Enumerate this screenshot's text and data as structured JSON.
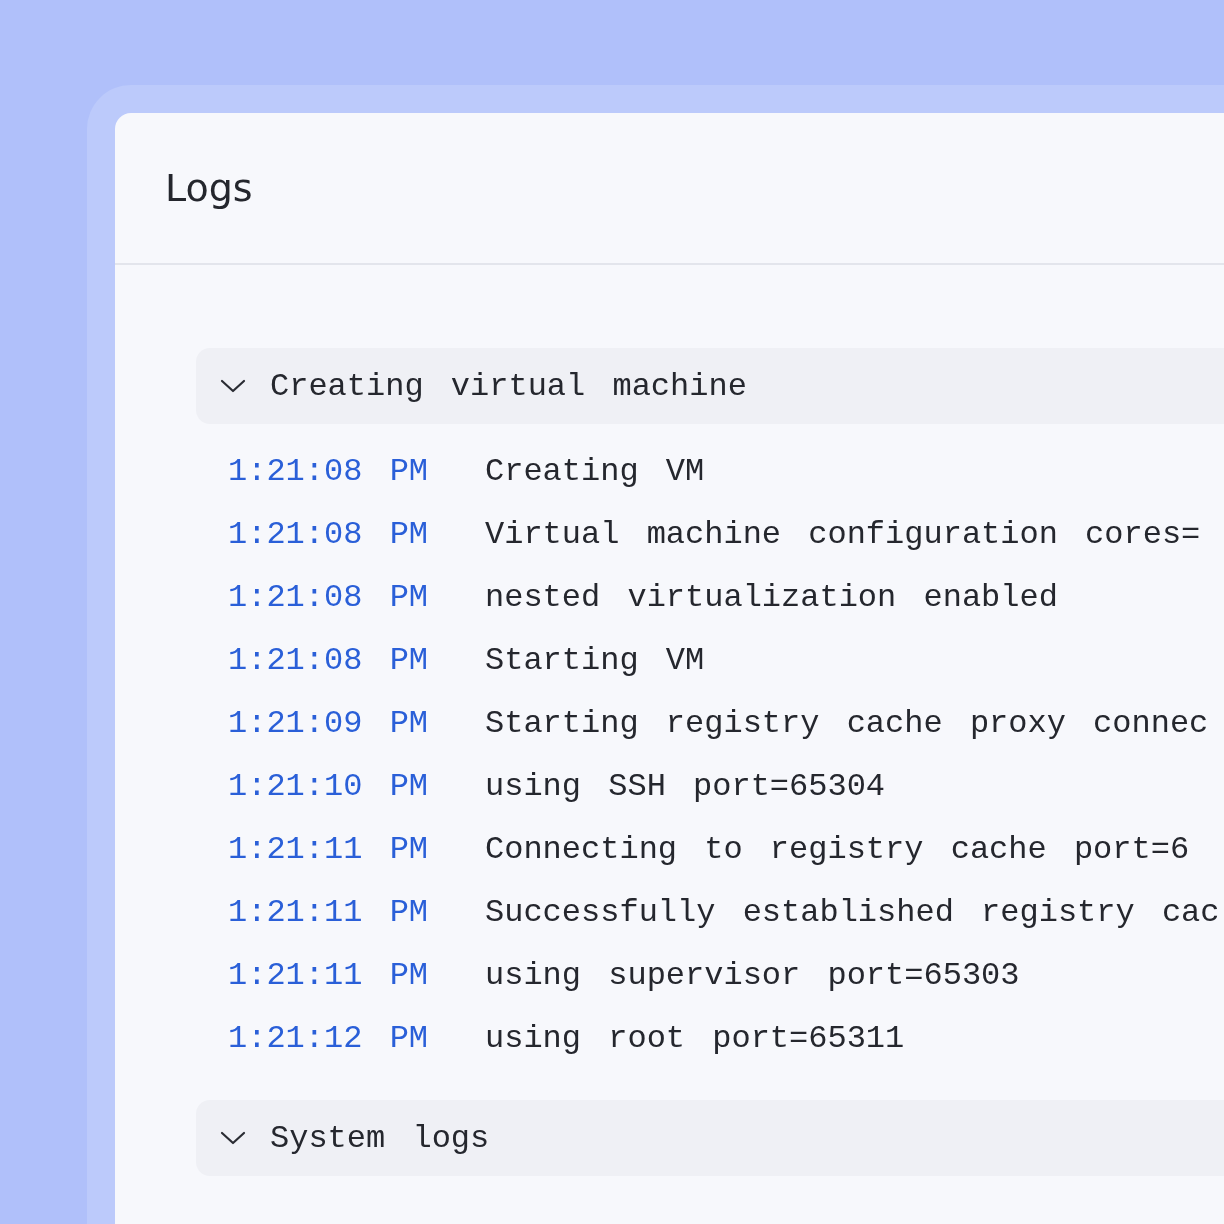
{
  "panel": {
    "title": "Logs"
  },
  "groups": [
    {
      "title": "Creating virtual machine",
      "expanded": true,
      "entries": [
        {
          "time": "1:21:08 PM",
          "message": "Creating VM"
        },
        {
          "time": "1:21:08 PM",
          "message": "Virtual machine configuration cores="
        },
        {
          "time": "1:21:08 PM",
          "message": "nested virtualization enabled"
        },
        {
          "time": "1:21:08 PM",
          "message": "Starting VM"
        },
        {
          "time": "1:21:09 PM",
          "message": "Starting registry cache proxy connec"
        },
        {
          "time": "1:21:10 PM",
          "message": "using SSH port=65304"
        },
        {
          "time": "1:21:11 PM",
          "message": "Connecting to registry cache port=6"
        },
        {
          "time": "1:21:11 PM",
          "message": "Successfully established registry cac"
        },
        {
          "time": "1:21:11 PM",
          "message": "using supervisor port=65303"
        },
        {
          "time": "1:21:12 PM",
          "message": "using root port=65311"
        }
      ]
    },
    {
      "title": "System logs",
      "expanded": true
    }
  ]
}
